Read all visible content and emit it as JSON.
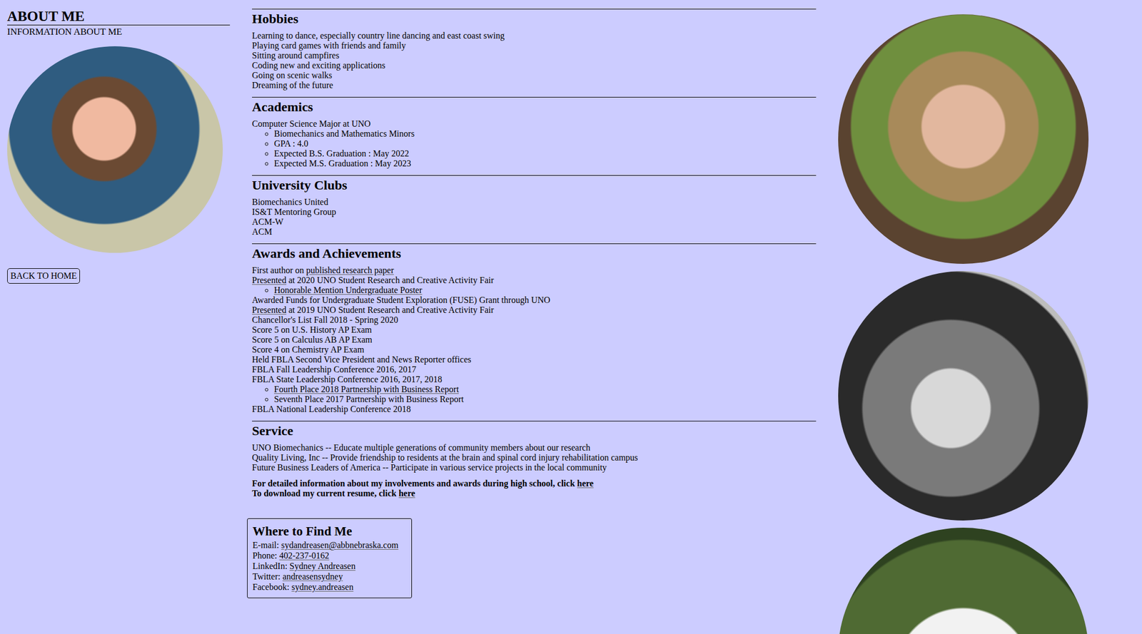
{
  "sidebar": {
    "title": "ABOUT ME",
    "subtitle": "INFORMATION ABOUT ME",
    "button": "BACK TO HOME"
  },
  "sections": [
    {
      "title": "Hobbies",
      "items": [
        {
          "kind": "line",
          "parts": [
            {
              "text": "Learning to dance, especially country line dancing and east coast swing",
              "link": false
            }
          ]
        },
        {
          "kind": "line",
          "parts": [
            {
              "text": "Playing card games with friends and family",
              "link": false
            }
          ]
        },
        {
          "kind": "line",
          "parts": [
            {
              "text": "Sitting around campfires",
              "link": false
            }
          ]
        },
        {
          "kind": "line",
          "parts": [
            {
              "text": "Coding new and exciting applications",
              "link": false
            }
          ]
        },
        {
          "kind": "line",
          "parts": [
            {
              "text": "Going on scenic walks",
              "link": false
            }
          ]
        },
        {
          "kind": "line",
          "parts": [
            {
              "text": "Dreaming of the future",
              "link": false
            }
          ]
        }
      ]
    },
    {
      "title": "Academics",
      "items": [
        {
          "kind": "line",
          "parts": [
            {
              "text": "Computer Science Major at UNO",
              "link": false
            }
          ]
        },
        {
          "kind": "sub",
          "parts": [
            {
              "text": "Biomechanics and Mathematics Minors",
              "link": false
            }
          ]
        },
        {
          "kind": "sub",
          "parts": [
            {
              "text": "GPA : 4.0",
              "link": false
            }
          ]
        },
        {
          "kind": "sub",
          "parts": [
            {
              "text": "Expected B.S. Graduation : May 2022",
              "link": false
            }
          ]
        },
        {
          "kind": "sub",
          "parts": [
            {
              "text": "Expected M.S. Graduation : May 2023",
              "link": false
            }
          ]
        }
      ]
    },
    {
      "title": "University Clubs",
      "items": [
        {
          "kind": "line",
          "parts": [
            {
              "text": "Biomechanics United",
              "link": false
            }
          ]
        },
        {
          "kind": "line",
          "parts": [
            {
              "text": "IS&T Mentoring Group",
              "link": false
            }
          ]
        },
        {
          "kind": "line",
          "parts": [
            {
              "text": "ACM-W",
              "link": false
            }
          ]
        },
        {
          "kind": "line",
          "parts": [
            {
              "text": "ACM",
              "link": false
            }
          ]
        }
      ]
    },
    {
      "title": "Awards and Achievements",
      "items": [
        {
          "kind": "line",
          "parts": [
            {
              "text": "First author on ",
              "link": false
            },
            {
              "text": "published research paper",
              "link": true
            }
          ]
        },
        {
          "kind": "line",
          "parts": [
            {
              "text": "Presented",
              "link": true
            },
            {
              "text": " at 2020 UNO Student Research and Creative Activity Fair",
              "link": false
            }
          ]
        },
        {
          "kind": "sub",
          "parts": [
            {
              "text": "Honorable Mention Undergraduate Poster",
              "link": true
            }
          ]
        },
        {
          "kind": "line",
          "parts": [
            {
              "text": "Awarded Funds for Undergraduate Student Exploration (FUSE) Grant through UNO",
              "link": false
            }
          ]
        },
        {
          "kind": "line",
          "parts": [
            {
              "text": "Presented",
              "link": true
            },
            {
              "text": " at 2019 UNO Student Research and Creative Activity Fair",
              "link": false
            }
          ]
        },
        {
          "kind": "line",
          "parts": [
            {
              "text": "Chancellor's List Fall 2018 - Spring 2020",
              "link": false
            }
          ]
        },
        {
          "kind": "line",
          "parts": [
            {
              "text": "Score 5 on U.S. History AP Exam",
              "link": false
            }
          ]
        },
        {
          "kind": "line",
          "parts": [
            {
              "text": "Score 5 on Calculus AB AP Exam",
              "link": false
            }
          ]
        },
        {
          "kind": "line",
          "parts": [
            {
              "text": "Score 4 on Chemistry AP Exam",
              "link": false
            }
          ]
        },
        {
          "kind": "line",
          "parts": [
            {
              "text": "Held FBLA Second Vice President and News Reporter offices",
              "link": false
            }
          ]
        },
        {
          "kind": "line",
          "parts": [
            {
              "text": "FBLA Fall Leadership Conference 2016, 2017",
              "link": false
            }
          ]
        },
        {
          "kind": "line",
          "parts": [
            {
              "text": "FBLA State Leadership Conference 2016, 2017, 2018",
              "link": false
            }
          ]
        },
        {
          "kind": "sub",
          "parts": [
            {
              "text": "Fourth Place 2018 Partnership with Business Report",
              "link": true
            }
          ]
        },
        {
          "kind": "sub",
          "parts": [
            {
              "text": "Seventh Place 2017 Partnership with Business Report",
              "link": false
            }
          ]
        },
        {
          "kind": "line",
          "parts": [
            {
              "text": "FBLA National Leadership Conference 2018",
              "link": false
            }
          ]
        }
      ]
    },
    {
      "title": "Service",
      "items": [
        {
          "kind": "line",
          "parts": [
            {
              "text": "UNO Biomechanics -- Educate multiple generations of community members about our research",
              "link": false
            }
          ]
        },
        {
          "kind": "line",
          "parts": [
            {
              "text": "Quality Living, Inc -- Provide friendship to residents at the brain and spinal cord injury rehabilitation campus",
              "link": false
            }
          ]
        },
        {
          "kind": "line",
          "parts": [
            {
              "text": "Future Business Leaders of America -- Participate in various service projects in the local community",
              "link": false
            }
          ]
        }
      ]
    }
  ],
  "notes": [
    [
      {
        "text": "For detailed information about my involvements and awards during high school, click ",
        "link": false
      },
      {
        "text": "here",
        "link": true
      }
    ],
    [
      {
        "text": "To download my current resume, click ",
        "link": false
      },
      {
        "text": "here",
        "link": true
      }
    ]
  ],
  "contact": {
    "title": "Where to Find Me",
    "rows": [
      {
        "label": "E-mail: ",
        "value": "sydandreasen@abbnebraska.com"
      },
      {
        "label": "Phone: ",
        "value": "402-237-0162"
      },
      {
        "label": "LinkedIn: ",
        "value": "Sydney Andreasen"
      },
      {
        "label": "Twitter: ",
        "value": "andreasensydney"
      },
      {
        "label": "Facebook: ",
        "value": "sydney.andreasen"
      }
    ]
  }
}
